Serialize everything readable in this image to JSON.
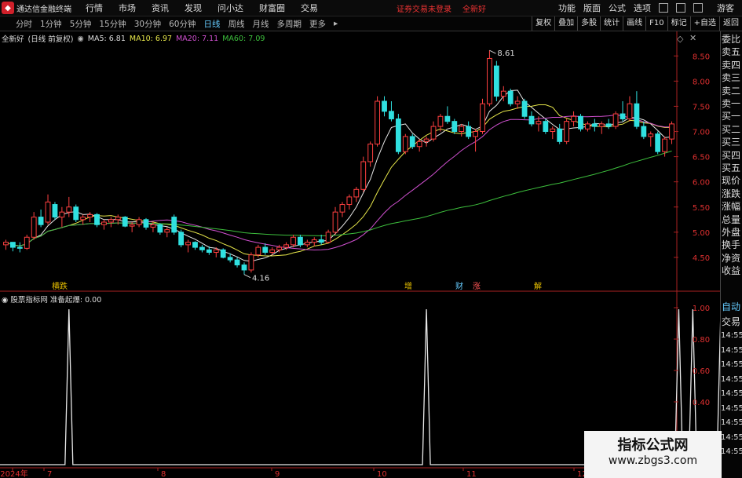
{
  "menubar": {
    "app_title": "通达信金融终端",
    "items": [
      "行情",
      "市场",
      "资讯",
      "发现",
      "问小达",
      "财富圈",
      "交易"
    ],
    "notice": "证券交易未登录",
    "stock": "全新好",
    "right_items": [
      "功能",
      "版面",
      "公式",
      "选项"
    ],
    "guest": "游客"
  },
  "timeframes": [
    "分时",
    "1分钟",
    "5分钟",
    "15分钟",
    "30分钟",
    "60分钟",
    "日线",
    "周线",
    "月线",
    "多周期",
    "更多"
  ],
  "active_timeframe": "日线",
  "toolbar_right": [
    "复权",
    "叠加",
    "多股",
    "统计",
    "画线",
    "F10",
    "标记",
    "+自选",
    "返回"
  ],
  "chart_header": {
    "name": "全新好",
    "mode": "(日线 前复权)",
    "ma": [
      {
        "label": "MA5:",
        "value": "6.81",
        "color": "#e8e8e8"
      },
      {
        "label": "MA10:",
        "value": "6.97",
        "color": "#e6e64a"
      },
      {
        "label": "MA20:",
        "value": "7.11",
        "color": "#d050d0"
      },
      {
        "label": "MA60:",
        "value": "7.09",
        "color": "#3dbf3d"
      }
    ]
  },
  "price_axis": [
    "8.50",
    "8.00",
    "7.50",
    "7.00",
    "6.50",
    "6.00",
    "5.50",
    "5.00",
    "4.50"
  ],
  "high_label": "8.61",
  "low_label": "4.16",
  "event_markers": [
    {
      "text": "横跌",
      "color": "#e8c000"
    },
    {
      "text": "增",
      "color": "#e8c000"
    },
    {
      "text": "财",
      "color": "#6cf"
    },
    {
      "text": "涨",
      "color": "#f55"
    },
    {
      "text": "解",
      "color": "#e8c000"
    }
  ],
  "indicator": {
    "source": "股票指标网",
    "name": "准备起爆:",
    "value": "0.00"
  },
  "ind_axis": [
    "1.00",
    "0.80",
    "0.60",
    "0.40",
    "0.20"
  ],
  "x_axis": [
    "2024年",
    "7",
    "8",
    "9",
    "10",
    "11",
    "12"
  ],
  "side_labels": [
    "委比",
    "卖五",
    "卖四",
    "卖三",
    "卖二",
    "卖一",
    "买一",
    "买二",
    "买三",
    "买四",
    "买五",
    "现价",
    "涨跌",
    "涨幅",
    "总量",
    "外盘",
    "换手",
    "净资",
    "收益"
  ],
  "side_lower": [
    "自动",
    "交易",
    "14:55",
    "14:55",
    "14:55",
    "14:55",
    "14:55",
    "14:55",
    "14:55",
    "14:55",
    "14:55"
  ],
  "watermark": {
    "line1": "指标公式网",
    "line2": "www.zbgs3.com"
  },
  "chart_data": {
    "type": "candlestick",
    "ylim": [
      4.0,
      8.8
    ],
    "candles": [
      [
        4.75,
        4.85,
        4.65,
        4.8
      ],
      [
        4.8,
        4.78,
        4.62,
        4.7
      ],
      [
        4.7,
        4.8,
        4.6,
        4.68
      ],
      [
        4.68,
        4.95,
        4.65,
        4.9
      ],
      [
        4.9,
        5.4,
        4.85,
        5.3
      ],
      [
        5.3,
        5.45,
        5.1,
        5.15
      ],
      [
        5.2,
        5.75,
        5.15,
        5.6
      ],
      [
        5.55,
        5.6,
        5.25,
        5.3
      ],
      [
        5.3,
        5.5,
        5.1,
        5.4
      ],
      [
        5.4,
        5.7,
        5.3,
        5.5
      ],
      [
        5.5,
        5.55,
        5.2,
        5.25
      ],
      [
        5.25,
        5.35,
        5.15,
        5.3
      ],
      [
        5.3,
        5.4,
        5.2,
        5.35
      ],
      [
        5.35,
        5.38,
        5.1,
        5.15
      ],
      [
        5.15,
        5.25,
        5.05,
        5.2
      ],
      [
        5.2,
        5.3,
        5.1,
        5.25
      ],
      [
        5.25,
        5.35,
        5.15,
        5.3
      ],
      [
        5.3,
        5.32,
        5.1,
        5.12
      ],
      [
        5.12,
        5.2,
        5.0,
        5.15
      ],
      [
        5.15,
        5.3,
        5.1,
        5.25
      ],
      [
        5.25,
        5.28,
        5.05,
        5.1
      ],
      [
        5.1,
        5.2,
        5.0,
        5.15
      ],
      [
        5.15,
        5.18,
        4.95,
        5.0
      ],
      [
        5.0,
        5.1,
        4.9,
        5.05
      ],
      [
        5.3,
        5.35,
        4.95,
        5.0
      ],
      [
        5.0,
        5.05,
        4.7,
        4.75
      ],
      [
        4.75,
        4.85,
        4.6,
        4.8
      ],
      [
        4.8,
        4.82,
        4.65,
        4.7
      ],
      [
        4.7,
        4.75,
        4.6,
        4.65
      ],
      [
        4.65,
        4.72,
        4.55,
        4.6
      ],
      [
        4.6,
        4.7,
        4.5,
        4.65
      ],
      [
        4.65,
        4.68,
        4.48,
        4.5
      ],
      [
        4.5,
        4.58,
        4.4,
        4.45
      ],
      [
        4.45,
        4.5,
        4.3,
        4.35
      ],
      [
        4.35,
        4.4,
        4.16,
        4.25
      ],
      [
        4.25,
        4.6,
        4.2,
        4.55
      ],
      [
        4.55,
        4.75,
        4.5,
        4.7
      ],
      [
        4.7,
        4.78,
        4.55,
        4.6
      ],
      [
        4.6,
        4.7,
        4.55,
        4.65
      ],
      [
        4.65,
        4.75,
        4.6,
        4.7
      ],
      [
        4.7,
        4.8,
        4.65,
        4.75
      ],
      [
        4.75,
        4.95,
        4.7,
        4.9
      ],
      [
        4.9,
        4.95,
        4.7,
        4.75
      ],
      [
        4.75,
        4.85,
        4.7,
        4.8
      ],
      [
        4.8,
        4.9,
        4.72,
        4.85
      ],
      [
        4.85,
        4.95,
        4.75,
        4.8
      ],
      [
        4.8,
        5.05,
        4.78,
        5.0
      ],
      [
        5.0,
        5.5,
        4.95,
        5.4
      ],
      [
        5.4,
        5.6,
        5.3,
        5.55
      ],
      [
        5.55,
        5.75,
        5.45,
        5.7
      ],
      [
        5.7,
        5.9,
        5.6,
        5.85
      ],
      [
        5.85,
        6.5,
        5.8,
        6.4
      ],
      [
        6.4,
        6.8,
        6.3,
        6.75
      ],
      [
        6.75,
        7.7,
        6.7,
        7.6
      ],
      [
        7.6,
        7.7,
        7.3,
        7.4
      ],
      [
        7.4,
        7.6,
        7.2,
        7.25
      ],
      [
        7.25,
        7.35,
        6.55,
        6.6
      ],
      [
        6.6,
        6.95,
        6.55,
        6.9
      ],
      [
        6.9,
        6.95,
        6.65,
        6.7
      ],
      [
        6.7,
        6.85,
        6.6,
        6.8
      ],
      [
        6.8,
        6.9,
        6.7,
        6.85
      ],
      [
        6.85,
        7.2,
        6.8,
        7.1
      ],
      [
        7.1,
        7.35,
        7.0,
        7.3
      ],
      [
        7.3,
        7.5,
        7.15,
        7.2
      ],
      [
        7.2,
        7.25,
        6.95,
        7.0
      ],
      [
        7.0,
        7.15,
        6.9,
        7.1
      ],
      [
        7.1,
        7.2,
        6.85,
        6.9
      ],
      [
        6.9,
        7.05,
        6.6,
        7.0
      ],
      [
        7.0,
        7.65,
        6.95,
        7.55
      ],
      [
        7.55,
        8.61,
        7.5,
        8.45
      ],
      [
        8.3,
        8.4,
        7.6,
        7.7
      ],
      [
        7.7,
        7.9,
        7.6,
        7.8
      ],
      [
        7.8,
        7.85,
        7.5,
        7.55
      ],
      [
        7.55,
        7.7,
        7.45,
        7.6
      ],
      [
        7.6,
        7.65,
        7.25,
        7.3
      ],
      [
        7.3,
        7.4,
        7.1,
        7.15
      ],
      [
        7.15,
        7.3,
        7.0,
        7.2
      ],
      [
        7.2,
        7.25,
        6.95,
        7.0
      ],
      [
        7.0,
        7.1,
        6.85,
        7.05
      ],
      [
        7.05,
        7.15,
        6.75,
        6.8
      ],
      [
        6.8,
        7.25,
        6.75,
        7.2
      ],
      [
        7.2,
        7.4,
        7.1,
        7.3
      ],
      [
        7.3,
        7.35,
        7.0,
        7.05
      ],
      [
        7.05,
        7.2,
        7.0,
        7.15
      ],
      [
        7.15,
        7.25,
        7.0,
        7.1
      ],
      [
        7.1,
        7.2,
        6.95,
        7.15
      ],
      [
        7.15,
        7.25,
        7.05,
        7.1
      ],
      [
        7.1,
        7.4,
        7.05,
        7.35
      ],
      [
        7.35,
        7.6,
        7.2,
        7.25
      ],
      [
        7.25,
        7.7,
        7.2,
        7.55
      ],
      [
        7.55,
        7.8,
        7.05,
        7.1
      ],
      [
        7.1,
        7.2,
        6.85,
        6.9
      ],
      [
        6.9,
        7.0,
        6.7,
        6.95
      ],
      [
        6.95,
        7.0,
        6.55,
        6.6
      ],
      [
        6.6,
        6.9,
        6.5,
        6.85
      ],
      [
        6.85,
        7.2,
        6.75,
        7.15
      ]
    ],
    "signal_peaks": [
      9,
      60,
      96,
      98,
      102
    ]
  }
}
